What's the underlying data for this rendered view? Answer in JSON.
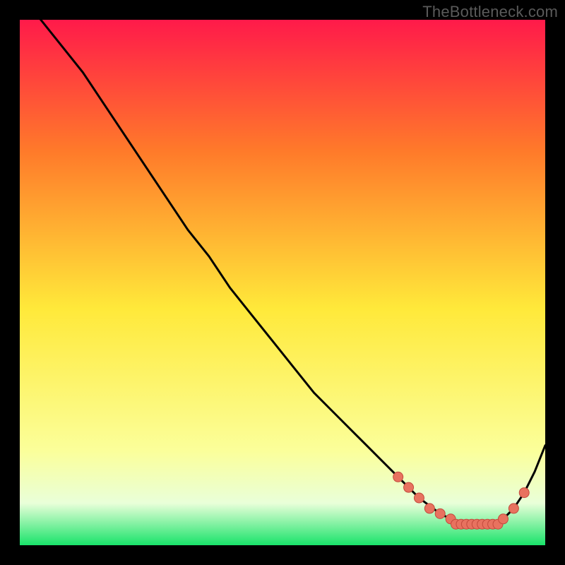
{
  "watermark": "TheBottleneck.com",
  "colors": {
    "page_bg": "#000000",
    "curve": "#000000",
    "marker_fill": "#e8725f",
    "marker_stroke": "#c34a3d",
    "gradient_stops": [
      {
        "offset": 0.0,
        "color": "#ff1a4a"
      },
      {
        "offset": 0.25,
        "color": "#ff7a2a"
      },
      {
        "offset": 0.55,
        "color": "#ffe93a"
      },
      {
        "offset": 0.82,
        "color": "#fbff9a"
      },
      {
        "offset": 0.92,
        "color": "#e9ffd9"
      },
      {
        "offset": 1.0,
        "color": "#19e36a"
      }
    ]
  },
  "chart_data": {
    "type": "line",
    "title": "",
    "xlabel": "",
    "ylabel": "",
    "xlim": [
      0,
      100
    ],
    "ylim": [
      0,
      100
    ],
    "grid": false,
    "legend": false,
    "series": [
      {
        "name": "curve",
        "style": "line",
        "x": [
          0,
          4,
          8,
          12,
          16,
          20,
          24,
          28,
          32,
          36,
          40,
          44,
          48,
          52,
          56,
          60,
          64,
          68,
          72,
          76,
          80,
          82,
          84,
          86,
          88,
          90,
          92,
          94,
          96,
          98,
          100
        ],
        "values": [
          104,
          100,
          95,
          90,
          84,
          78,
          72,
          66,
          60,
          55,
          49,
          44,
          39,
          34,
          29,
          25,
          21,
          17,
          13,
          9,
          6,
          5,
          4,
          4,
          4,
          4,
          5,
          7,
          10,
          14,
          19
        ]
      },
      {
        "name": "optimal-points",
        "style": "markers",
        "x": [
          72,
          74,
          76,
          78,
          80,
          82,
          83,
          84,
          85,
          86,
          87,
          88,
          89,
          90,
          91,
          92,
          94,
          96
        ],
        "values": [
          13,
          11,
          9,
          7,
          6,
          5,
          4,
          4,
          4,
          4,
          4,
          4,
          4,
          4,
          4,
          5,
          7,
          10
        ]
      }
    ]
  }
}
